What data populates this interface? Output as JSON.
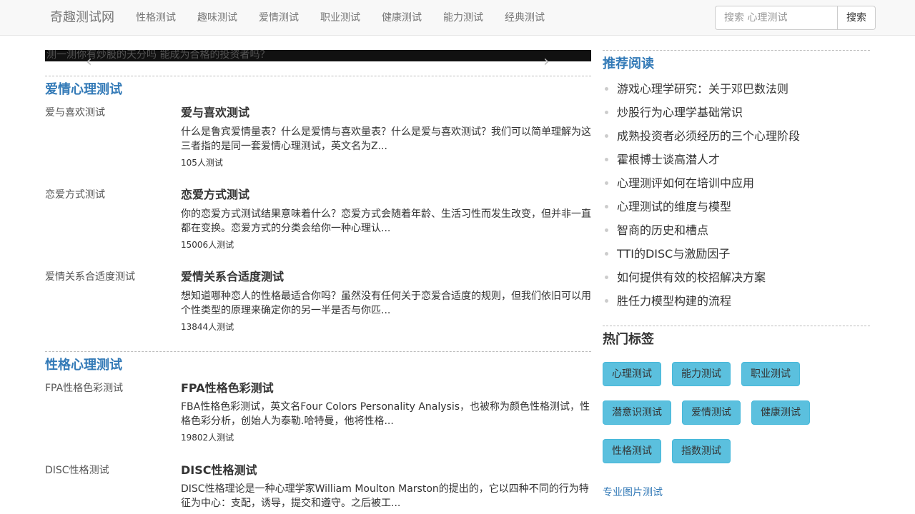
{
  "navbar": {
    "brand": "奇趣测试网",
    "items": [
      "性格测试",
      "趣味测试",
      "爱情测试",
      "职业测试",
      "健康测试",
      "能力测试",
      "经典测试"
    ],
    "search_placeholder": "搜索 心理测试",
    "search_button": "搜索"
  },
  "carousel": {
    "caption": "测一测你有炒股的天分吗 能成为合格的投资者吗？",
    "prev": "‹",
    "next": "›"
  },
  "sections": [
    {
      "title": "爱情心理测试",
      "items": [
        {
          "image_alt": "爱与喜欢测试",
          "title": "爱与喜欢测试",
          "desc": "什么是鲁宾爱情量表？什么是爱情与喜欢量表？什么是爱与喜欢测试？我们可以简单理解为这三者指的是同一套爱情心理测试，英文名为Z...",
          "count": "105人测试"
        },
        {
          "image_alt": "恋爱方式测试",
          "title": "恋爱方式测试",
          "desc": "你的恋爱方式测试结果意味着什么？恋爱方式会随着年龄、生活习性而发生改变，但并非一直都在变换。恋爱方式的分类会给你一种心理认...",
          "count": "15006人测试"
        },
        {
          "image_alt": "爱情关系合适度测试",
          "title": "爱情关系合适度测试",
          "desc": "想知道哪种恋人的性格最适合你吗？虽然没有任何关于恋爱合适度的规则，但我们依旧可以用个性类型的原理来确定你的另一半是否与你匹...",
          "count": "13844人测试"
        }
      ]
    },
    {
      "title": "性格心理测试",
      "items": [
        {
          "image_alt": "FPA性格色彩测试",
          "title": "FPA性格色彩测试",
          "desc": "FBA性格色彩测试，英文名Four Colors Personality Analysis，也被称为颜色性格测试，性格色彩分析，创始人为泰勒.哈特曼，他将性格...",
          "count": "19802人测试"
        },
        {
          "image_alt": "DISC性格测试",
          "title": "DISC性格测试",
          "desc": "DISC性格理论是一种心理学家William Moulton Marston的提出的，它以四种不同的行为特征为中心：支配，诱导，提交和遵守。之后被工...",
          "count": ""
        }
      ]
    }
  ],
  "sidebar": {
    "recommended_title": "推荐阅读",
    "recommended": [
      "游戏心理学研究：关于邓巴数法则",
      "炒股行为心理学基础常识",
      "成熟投资者必须经历的三个心理阶段",
      "霍根博士谈高潜人才",
      "心理测评如何在培训中应用",
      "心理测试的维度与模型",
      "智商的历史和槽点",
      "TTI的DISC与激励因子",
      "如何提供有效的校招解决方案",
      "胜任力模型构建的流程"
    ],
    "tags_title": "热门标签",
    "tags": [
      "心理测试",
      "能力测试",
      "职业测试",
      "潜意识测试",
      "爱情测试",
      "健康测试",
      "性格测试",
      "指数测试"
    ],
    "image_alt": "专业图片测试"
  },
  "colors": {
    "link": "#337ab7",
    "tag_bg": "#5bc0de",
    "navbar_bg": "#f8f8f8"
  }
}
